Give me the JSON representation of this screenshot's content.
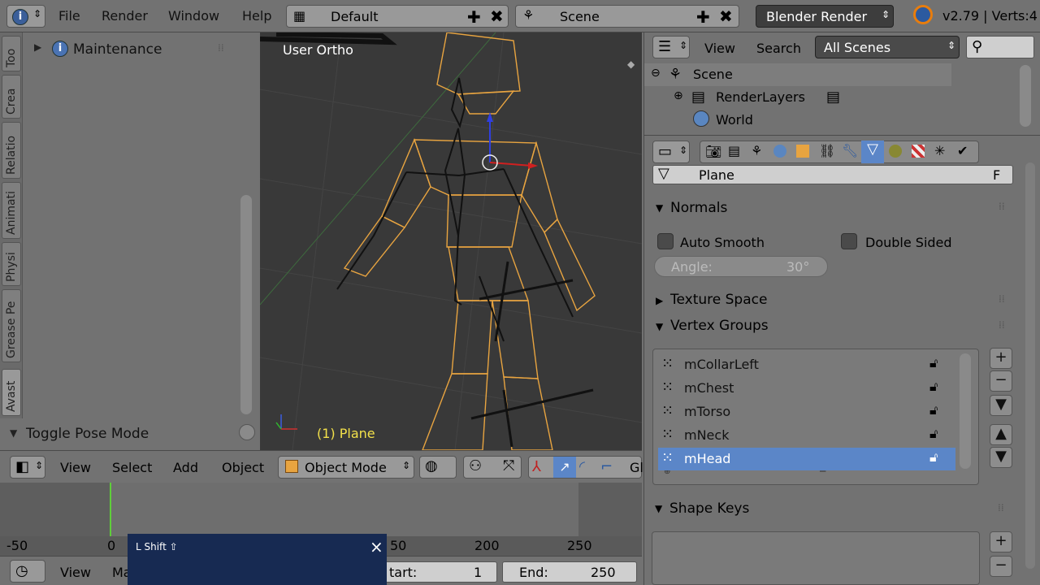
{
  "topbar": {
    "menu": [
      "File",
      "Render",
      "Window",
      "Help"
    ],
    "layout": "Default",
    "scene": "Scene",
    "engine": "Blender Render",
    "version": "v2.79 | Verts:4"
  },
  "toolshelf": {
    "tabs": [
      "Too",
      "Crea",
      "Relatio",
      "Animati",
      "Physi",
      "Grease Pe",
      "Avast"
    ],
    "panel_title": "Maintenance",
    "toggle_label": "Toggle Pose Mode"
  },
  "viewport": {
    "view_name": "User Ortho",
    "object_label": "(1) Plane"
  },
  "view_header": {
    "items": [
      "View",
      "Select",
      "Add",
      "Object"
    ],
    "mode": "Object Mode",
    "trail": "Gl"
  },
  "timeline": {
    "ticks": [
      "-50",
      "0",
      "50",
      "200",
      "250"
    ],
    "current_frame": 0
  },
  "timeline_header": {
    "view": "View",
    "marker": "Ma",
    "start_label": "tart:",
    "start_value": "1",
    "end_label": "End:",
    "end_value": "250"
  },
  "key_popup": {
    "text": "L Shift ⇧",
    "close": "×"
  },
  "outliner": {
    "view": "View",
    "search": "Search",
    "filter": "All Scenes",
    "items": [
      "Scene",
      "RenderLayers",
      "World"
    ]
  },
  "properties": {
    "datablock": "Plane",
    "fake_user": "F",
    "normals": {
      "title": "Normals",
      "auto_smooth": "Auto Smooth",
      "double_sided": "Double Sided",
      "angle_label": "Angle:",
      "angle_value": "30°"
    },
    "texture_space": "Texture Space",
    "vertex_groups": {
      "title": "Vertex Groups",
      "groups": [
        "mCollarLeft",
        "mChest",
        "mTorso",
        "mNeck",
        "mHead"
      ],
      "selected": "mHead"
    },
    "shape_keys": "Shape Keys"
  },
  "colors": {
    "selection": "#5b86c8",
    "wire": "#e8a440",
    "viewport_bg": "#393939",
    "popup_bg": "#172a52"
  }
}
